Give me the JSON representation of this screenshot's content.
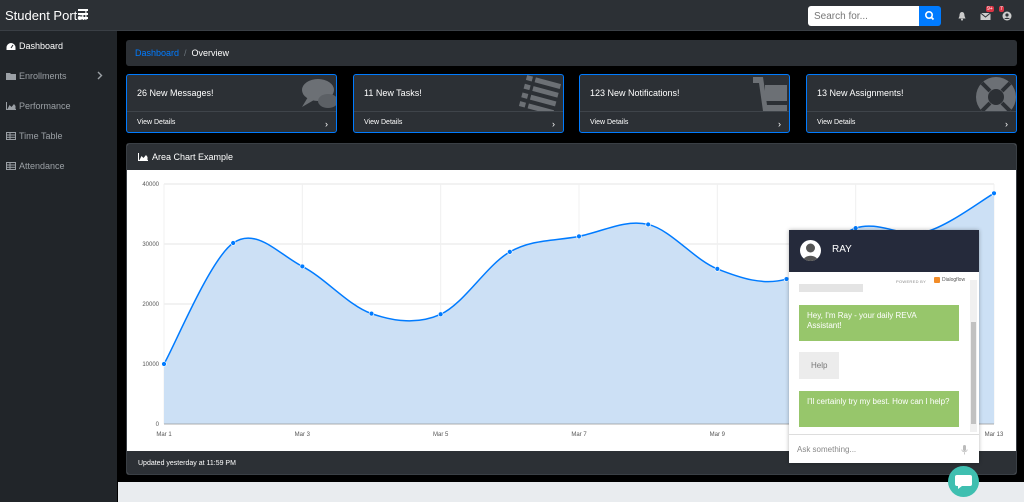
{
  "app": {
    "title": "Student Portal"
  },
  "search": {
    "placeholder": "Search for..."
  },
  "navbar": {
    "messages_badge": "9+",
    "alerts_badge": "7"
  },
  "sidebar": {
    "items": [
      {
        "label": "Dashboard",
        "icon": "dashboard-icon"
      },
      {
        "label": "Enrollments",
        "icon": "folder-icon"
      },
      {
        "label": "Performance",
        "icon": "area-chart-icon"
      },
      {
        "label": "Time Table",
        "icon": "table-icon"
      },
      {
        "label": "Attendance",
        "icon": "table-icon"
      }
    ]
  },
  "breadcrumb": {
    "link": "Dashboard",
    "current": "Overview"
  },
  "cards": [
    {
      "title": "26 New Messages!",
      "link": "View Details",
      "icon": "comments-icon"
    },
    {
      "title": "11 New Tasks!",
      "link": "View Details",
      "icon": "list-icon"
    },
    {
      "title": "123 New Notifications!",
      "link": "View Details",
      "icon": "shopping-cart-icon"
    },
    {
      "title": "13 New Assignments!",
      "link": "View Details",
      "icon": "life-ring-icon"
    }
  ],
  "chart_panel": {
    "title": "Area Chart Example",
    "footer": "Updated yesterday at 11:59 PM"
  },
  "chart_data": {
    "type": "area",
    "title": "Area Chart Example",
    "x_tick_labels": [
      "Mar 1",
      "Mar 3",
      "Mar 5",
      "Mar 7",
      "Mar 9",
      "Mar 11",
      "Mar 13"
    ],
    "x": [
      "Mar 1",
      "Mar 2",
      "Mar 3",
      "Mar 4",
      "Mar 5",
      "Mar 6",
      "Mar 7",
      "Mar 8",
      "Mar 9",
      "Mar 10",
      "Mar 11",
      "Mar 12",
      "Mar 13"
    ],
    "values": [
      10000,
      30162,
      26263,
      18394,
      18287,
      28682,
      31274,
      33259,
      25849,
      24159,
      32651,
      31984,
      38451
    ],
    "ylim": [
      0,
      40000
    ],
    "y_ticks": [
      0,
      10000,
      20000,
      30000,
      40000
    ],
    "grid": true,
    "colors": {
      "line": "#007bff",
      "fill": "#cce0f5"
    }
  },
  "chat": {
    "bot_name": "RAY",
    "powered_by": "POWERED BY",
    "powered_brand": "Dialogflow",
    "messages": [
      {
        "from": "bot",
        "text": "Hey, I'm Ray - your daily REVA Assistant!"
      },
      {
        "from": "user",
        "text": "Help"
      },
      {
        "from": "bot",
        "text": "I'll certainly try my best. How can I help?"
      }
    ],
    "input_placeholder": "Ask something..."
  }
}
